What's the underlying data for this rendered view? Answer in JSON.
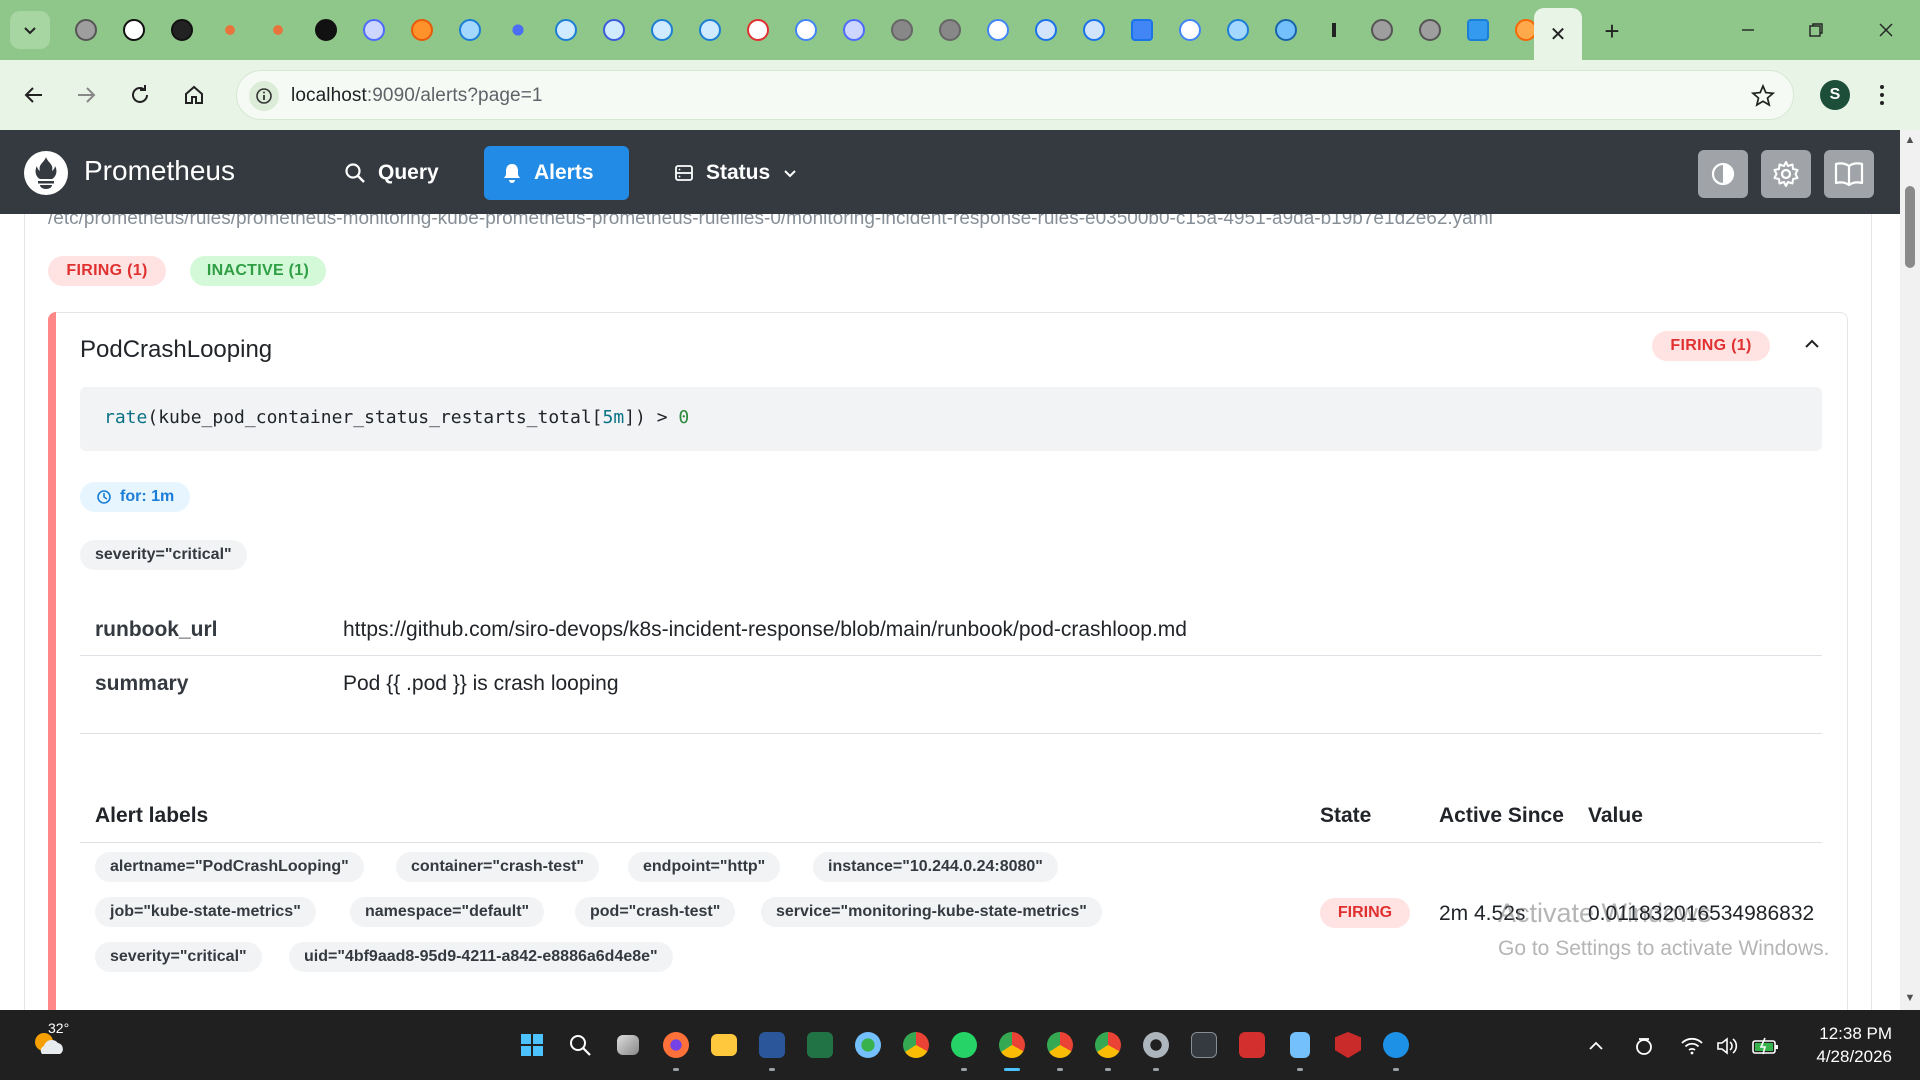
{
  "browser": {
    "address": {
      "host": "localhost",
      "rest": ":9090/alerts?page=1"
    },
    "profile_initial": "S",
    "new_tab_glyph": "+",
    "close_tab_glyph": "✕"
  },
  "app": {
    "brand": "Prometheus",
    "nav": {
      "query": "Query",
      "alerts": "Alerts",
      "status": "Status"
    }
  },
  "rules_group": {
    "file_path": "/etc/prometheus/rules/prometheus-monitoring-kube-prometheus-prometheus-rulefiles-0/monitoring-incident-response-rules-e03500b0-c15a-4951-a9da-b19b7e1d2e62.yaml",
    "firing_badge": "FIRING (1)",
    "inactive_badge": "INACTIVE (1)"
  },
  "rule": {
    "name": "PodCrashLooping",
    "state_badge": "FIRING (1)",
    "expr": {
      "fn": "rate",
      "open": "(kube_pod_container_status_restarts_total[",
      "duration": "5m",
      "close": "]) > ",
      "threshold": "0"
    },
    "for": "for: 1m",
    "labels": [
      "severity=\"critical\""
    ],
    "annotations": [
      {
        "key": "runbook_url",
        "value": "https://github.com/siro-devops/k8s-incident-response/blob/main/runbook/pod-crashloop.md"
      },
      {
        "key": "summary",
        "value": "Pod {{ .pod }} is crash looping"
      }
    ],
    "table": {
      "headers": {
        "labels": "Alert labels",
        "state": "State",
        "active_since": "Active Since",
        "value": "Value"
      },
      "row": {
        "labels": [
          "alertname=\"PodCrashLooping\"",
          "container=\"crash-test\"",
          "endpoint=\"http\"",
          "instance=\"10.244.0.24:8080\"",
          "job=\"kube-state-metrics\"",
          "namespace=\"default\"",
          "pod=\"crash-test\"",
          "service=\"monitoring-kube-state-metrics\"",
          "severity=\"critical\"",
          "uid=\"4bf9aad8-95d9-4211-a842-e8886a6d4e8e\""
        ],
        "state": "FIRING",
        "active_since": "2m 4.52s",
        "value": "0.011832016534986832"
      }
    }
  },
  "watermark": {
    "line1": "Activate Windows",
    "line2": "Go to Settings to activate Windows."
  },
  "taskbar": {
    "temperature": "32°",
    "time": "12:38 PM",
    "date": "4/28/2026"
  },
  "colors": {
    "tabstrip": "#8fc68a",
    "navbar": "#343a40",
    "accent": "#228be6",
    "firing": "#e03131",
    "inactive": "#2f9e44"
  }
}
